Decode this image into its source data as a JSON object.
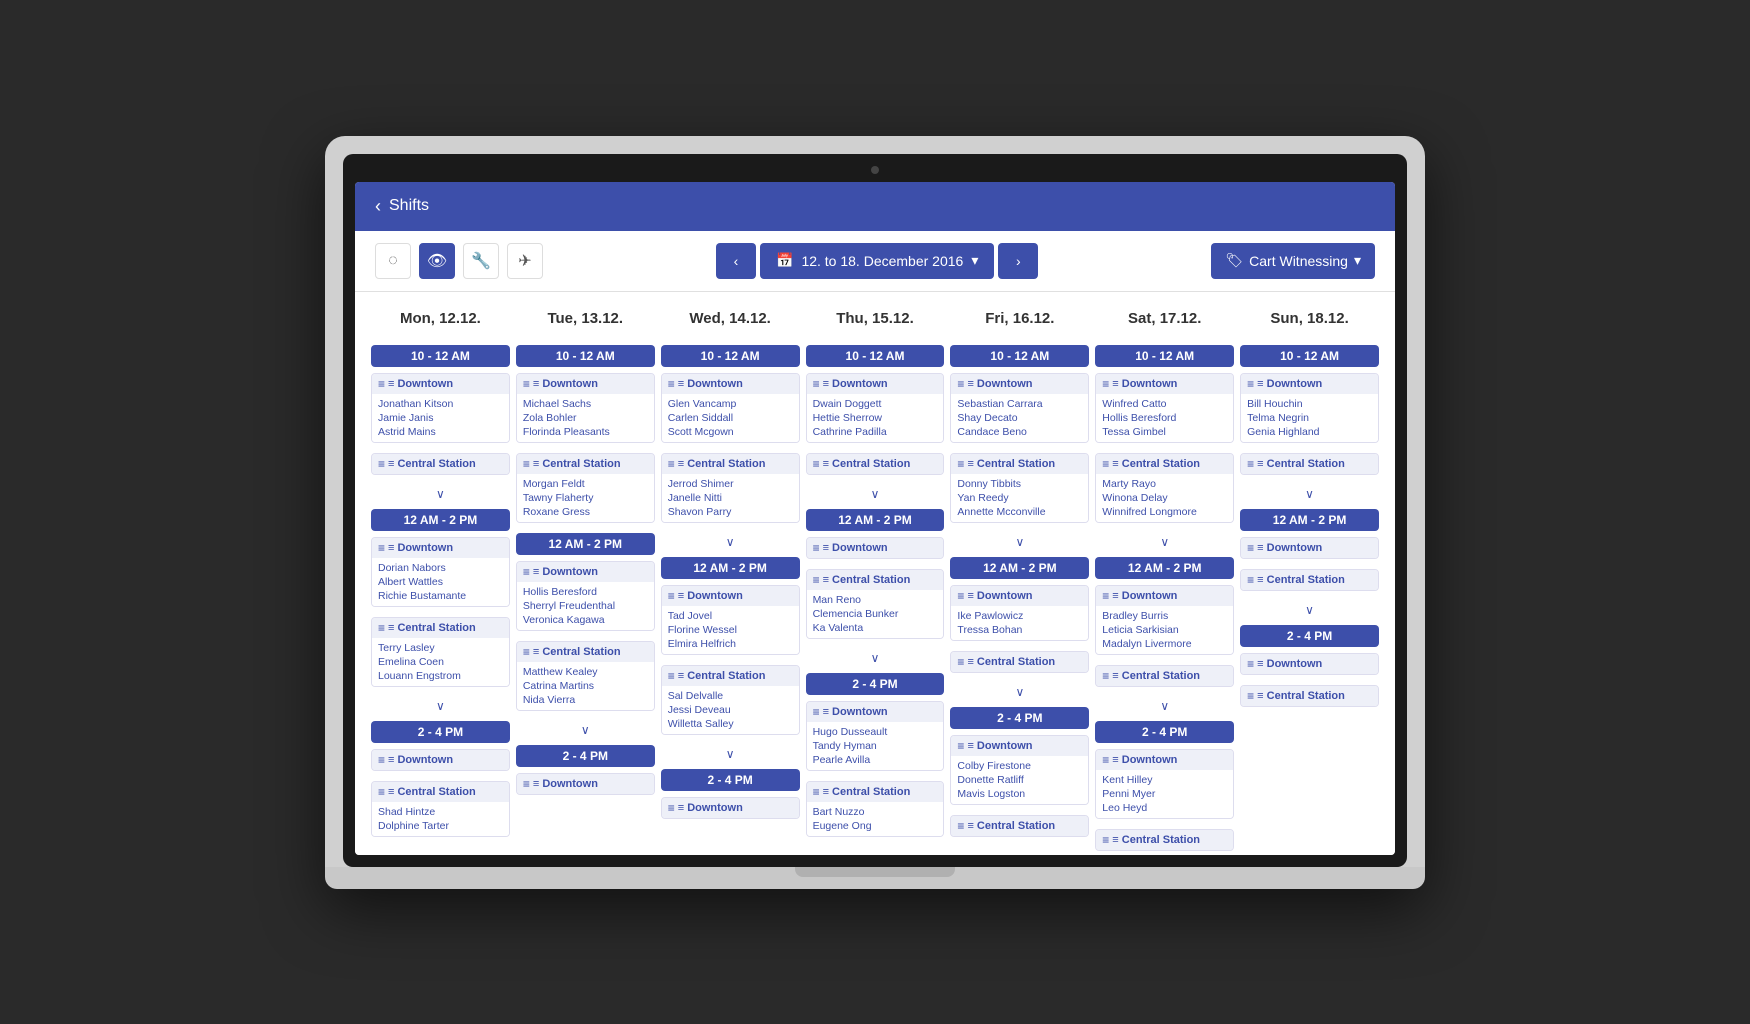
{
  "app": {
    "title": "Shifts",
    "back_label": "‹"
  },
  "toolbar": {
    "icons": [
      {
        "name": "eye-off-icon",
        "symbol": "👁",
        "active": false
      },
      {
        "name": "eye-icon",
        "symbol": "👁",
        "active": true
      },
      {
        "name": "wrench-icon",
        "symbol": "🔧",
        "active": false
      },
      {
        "name": "send-icon",
        "symbol": "✈",
        "active": false
      }
    ],
    "prev_label": "‹",
    "next_label": "›",
    "date_range": "12. to 18. December 2016",
    "date_icon": "📅",
    "dropdown_arrow": "▾",
    "filter_label": "Cart Witnessing",
    "filter_icon": "🏷",
    "filter_arrow": "▾"
  },
  "days": [
    {
      "label": "Mon, 12.12.",
      "short": "mon"
    },
    {
      "label": "Tue, 13.12.",
      "short": "tue"
    },
    {
      "label": "Wed, 14.12.",
      "short": "wed"
    },
    {
      "label": "Thu, 15.12.",
      "short": "thu"
    },
    {
      "label": "Fri, 16.12.",
      "short": "fri"
    },
    {
      "label": "Sat, 17.12.",
      "short": "sat"
    },
    {
      "label": "Sun, 18.12.",
      "short": "sun"
    }
  ],
  "shifts": {
    "mon": [
      {
        "time": "10 - 12 AM",
        "groups": [
          {
            "location": "Downtown",
            "persons": [
              "Jonathan Kitson",
              "Jamie Janis",
              "Astrid Mains"
            ]
          },
          {
            "location": "Central Station",
            "persons": []
          }
        ],
        "has_expand": true
      },
      {
        "time": "12 AM - 2 PM",
        "groups": [
          {
            "location": "Downtown",
            "persons": [
              "Dorian Nabors",
              "Albert Wattles",
              "Richie Bustamante"
            ]
          },
          {
            "location": "Central Station",
            "persons": [
              "Terry Lasley",
              "Emelina Coen",
              "Louann Engstrom"
            ]
          }
        ],
        "has_expand": true
      },
      {
        "time": "2 - 4 PM",
        "groups": [
          {
            "location": "Downtown",
            "persons": []
          },
          {
            "location": "Central Station",
            "persons": [
              "Shad Hintze",
              "Dolphine Tarter"
            ]
          }
        ],
        "has_expand": false
      }
    ],
    "tue": [
      {
        "time": "10 - 12 AM",
        "groups": [
          {
            "location": "Downtown",
            "persons": [
              "Michael Sachs",
              "Zola Bohler",
              "Florinda Pleasants"
            ]
          },
          {
            "location": "Central Station",
            "persons": [
              "Morgan Feldt",
              "Tawny Flaherty",
              "Roxane Gress"
            ]
          }
        ],
        "has_expand": false
      },
      {
        "time": "12 AM - 2 PM",
        "groups": [
          {
            "location": "Downtown",
            "persons": [
              "Hollis Beresford",
              "Sherryl Freudenthal",
              "Veronica Kagawa"
            ]
          },
          {
            "location": "Central Station",
            "persons": [
              "Matthew Kealey",
              "Catrina Martins",
              "Nida Vierra"
            ]
          }
        ],
        "has_expand": true
      },
      {
        "time": "2 - 4 PM",
        "groups": [
          {
            "location": "Downtown",
            "persons": []
          }
        ],
        "has_expand": false
      }
    ],
    "wed": [
      {
        "time": "10 - 12 AM",
        "groups": [
          {
            "location": "Downtown",
            "persons": [
              "Glen Vancamp",
              "Carlen Siddall",
              "Scott Mcgown"
            ]
          },
          {
            "location": "Central Station",
            "persons": [
              "Jerrod Shimer",
              "Janelle Nitti",
              "Shavon Parry"
            ]
          }
        ],
        "has_expand": true
      },
      {
        "time": "12 AM - 2 PM",
        "groups": [
          {
            "location": "Downtown",
            "persons": [
              "Tad Jovel",
              "Florine Wessel",
              "Elmira Helfrich"
            ]
          },
          {
            "location": "Central Station",
            "persons": [
              "Sal Delvalle",
              "Jessi Deveau",
              "Willetta Salley"
            ]
          }
        ],
        "has_expand": true
      },
      {
        "time": "2 - 4 PM",
        "groups": [
          {
            "location": "Downtown",
            "persons": []
          }
        ],
        "has_expand": false
      }
    ],
    "thu": [
      {
        "time": "10 - 12 AM",
        "groups": [
          {
            "location": "Downtown",
            "persons": [
              "Dwain Doggett",
              "Hettie Sherrow",
              "Cathrine Padilla"
            ]
          },
          {
            "location": "Central Station",
            "persons": []
          }
        ],
        "has_expand": true
      },
      {
        "time": "12 AM - 2 PM",
        "groups": [
          {
            "location": "Downtown",
            "persons": []
          },
          {
            "location": "Central Station",
            "persons": [
              "Man Reno",
              "Clemencia Bunker",
              "Ka Valenta"
            ]
          }
        ],
        "has_expand": true
      },
      {
        "time": "2 - 4 PM",
        "groups": [
          {
            "location": "Downtown",
            "persons": [
              "Hugo Dusseault",
              "Tandy Hyman",
              "Pearle Avilla"
            ]
          },
          {
            "location": "Central Station",
            "persons": [
              "Bart Nuzzo",
              "Eugene Ong"
            ]
          }
        ],
        "has_expand": false
      }
    ],
    "fri": [
      {
        "time": "10 - 12 AM",
        "groups": [
          {
            "location": "Downtown",
            "persons": [
              "Sebastian Carrara",
              "Shay Decato",
              "Candace Beno"
            ]
          },
          {
            "location": "Central Station",
            "persons": [
              "Donny Tibbits",
              "Yan Reedy",
              "Annette Mcconville"
            ]
          }
        ],
        "has_expand": true
      },
      {
        "time": "12 AM - 2 PM",
        "groups": [
          {
            "location": "Downtown",
            "persons": [
              "Ike Pawlowicz",
              "Tressa Bohan"
            ]
          },
          {
            "location": "Central Station",
            "persons": []
          }
        ],
        "has_expand": true
      },
      {
        "time": "2 - 4 PM",
        "groups": [
          {
            "location": "Downtown",
            "persons": [
              "Colby Firestone",
              "Donette Ratliff",
              "Mavis Logston"
            ]
          },
          {
            "location": "Central Station",
            "persons": []
          }
        ],
        "has_expand": false
      }
    ],
    "sat": [
      {
        "time": "10 - 12 AM",
        "groups": [
          {
            "location": "Downtown",
            "persons": [
              "Winfred Catto",
              "Hollis Beresford",
              "Tessa Gimbel"
            ]
          },
          {
            "location": "Central Station",
            "persons": [
              "Marty Rayo",
              "Winona Delay",
              "Winnifred Longmore"
            ]
          }
        ],
        "has_expand": true
      },
      {
        "time": "12 AM - 2 PM",
        "groups": [
          {
            "location": "Downtown",
            "persons": [
              "Bradley Burris",
              "Leticia Sarkisian",
              "Madalyn Livermore"
            ]
          },
          {
            "location": "Central Station",
            "persons": []
          }
        ],
        "has_expand": true
      },
      {
        "time": "2 - 4 PM",
        "groups": [
          {
            "location": "Downtown",
            "persons": [
              "Kent Hilley",
              "Penni Myer",
              "Leo Heyd"
            ]
          },
          {
            "location": "Central Station",
            "persons": []
          }
        ],
        "has_expand": false
      }
    ],
    "sun": [
      {
        "time": "10 - 12 AM",
        "groups": [
          {
            "location": "Downtown",
            "persons": [
              "Bill Houchin",
              "Telma Negrin",
              "Genia Highland"
            ]
          },
          {
            "location": "Central Station",
            "persons": []
          }
        ],
        "has_expand": true
      },
      {
        "time": "12 AM - 2 PM",
        "groups": [
          {
            "location": "Downtown",
            "persons": []
          },
          {
            "location": "Central Station",
            "persons": []
          }
        ],
        "has_expand": true
      },
      {
        "time": "2 - 4 PM",
        "groups": [
          {
            "location": "Downtown",
            "persons": []
          },
          {
            "location": "Central Station",
            "persons": []
          }
        ],
        "has_expand": false
      }
    ]
  }
}
